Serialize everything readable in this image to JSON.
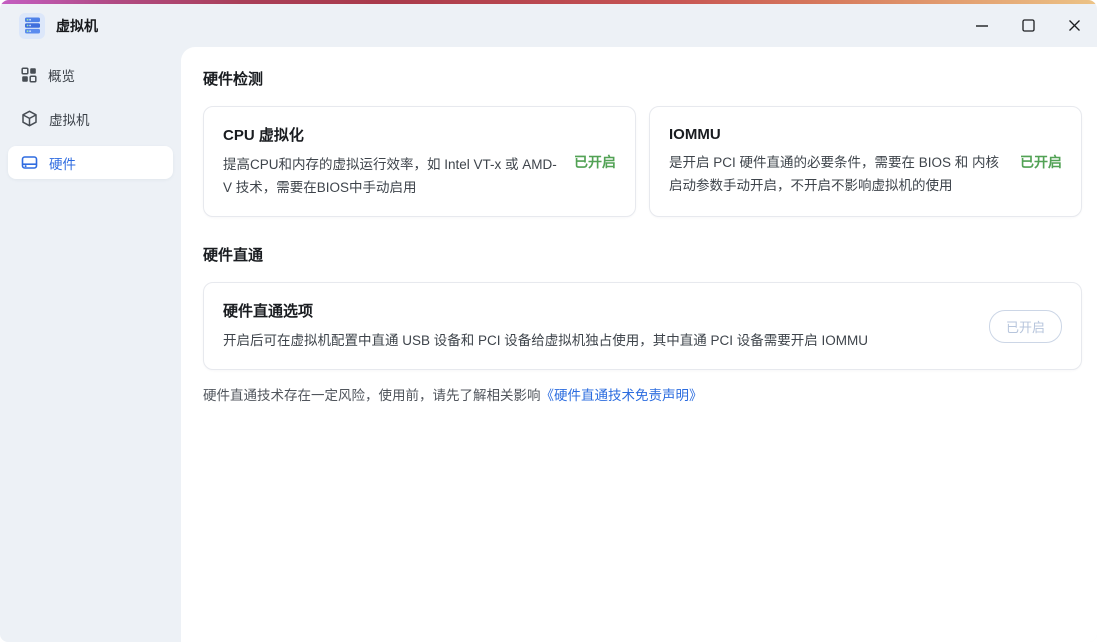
{
  "window": {
    "title": "虚拟机",
    "controls": {
      "minimize": "minimize",
      "maximize": "maximize",
      "close": "close"
    }
  },
  "colors": {
    "accent_blue": "#2e6be0",
    "status_green": "#52a255",
    "link_blue": "#2b6cdf",
    "sidebar_bg": "#edf1f6",
    "gradient": [
      "#c45ec2",
      "#a93a4b",
      "#c85754",
      "#ecc386"
    ]
  },
  "sidebar": {
    "items": [
      {
        "label": "概览",
        "icon": "grid-icon",
        "selected": false
      },
      {
        "label": "虚拟机",
        "icon": "cube-icon",
        "selected": false
      },
      {
        "label": "硬件",
        "icon": "drive-icon",
        "selected": true
      }
    ]
  },
  "main": {
    "detection": {
      "heading": "硬件检测",
      "cards": [
        {
          "title": "CPU 虚拟化",
          "description": "提高CPU和内存的虚拟运行效率，如 Intel VT-x 或 AMD-V 技术，需要在BIOS中手动启用",
          "status": "已开启"
        },
        {
          "title": "IOMMU",
          "description": "是开启 PCI 硬件直通的必要条件，需要在 BIOS 和 内核启动参数手动开启，不开启不影响虚拟机的使用",
          "status": "已开启"
        }
      ]
    },
    "passthrough": {
      "heading": "硬件直通",
      "card": {
        "title": "硬件直通选项",
        "description": "开启后可在虚拟机配置中直通 USB 设备和 PCI 设备给虚拟机独占使用，其中直通 PCI 设备需要开启 IOMMU",
        "button": "已开启"
      },
      "notice": "硬件直通技术存在一定风险，使用前，请先了解相关影响",
      "notice_link": "《硬件直通技术免责声明》"
    }
  }
}
